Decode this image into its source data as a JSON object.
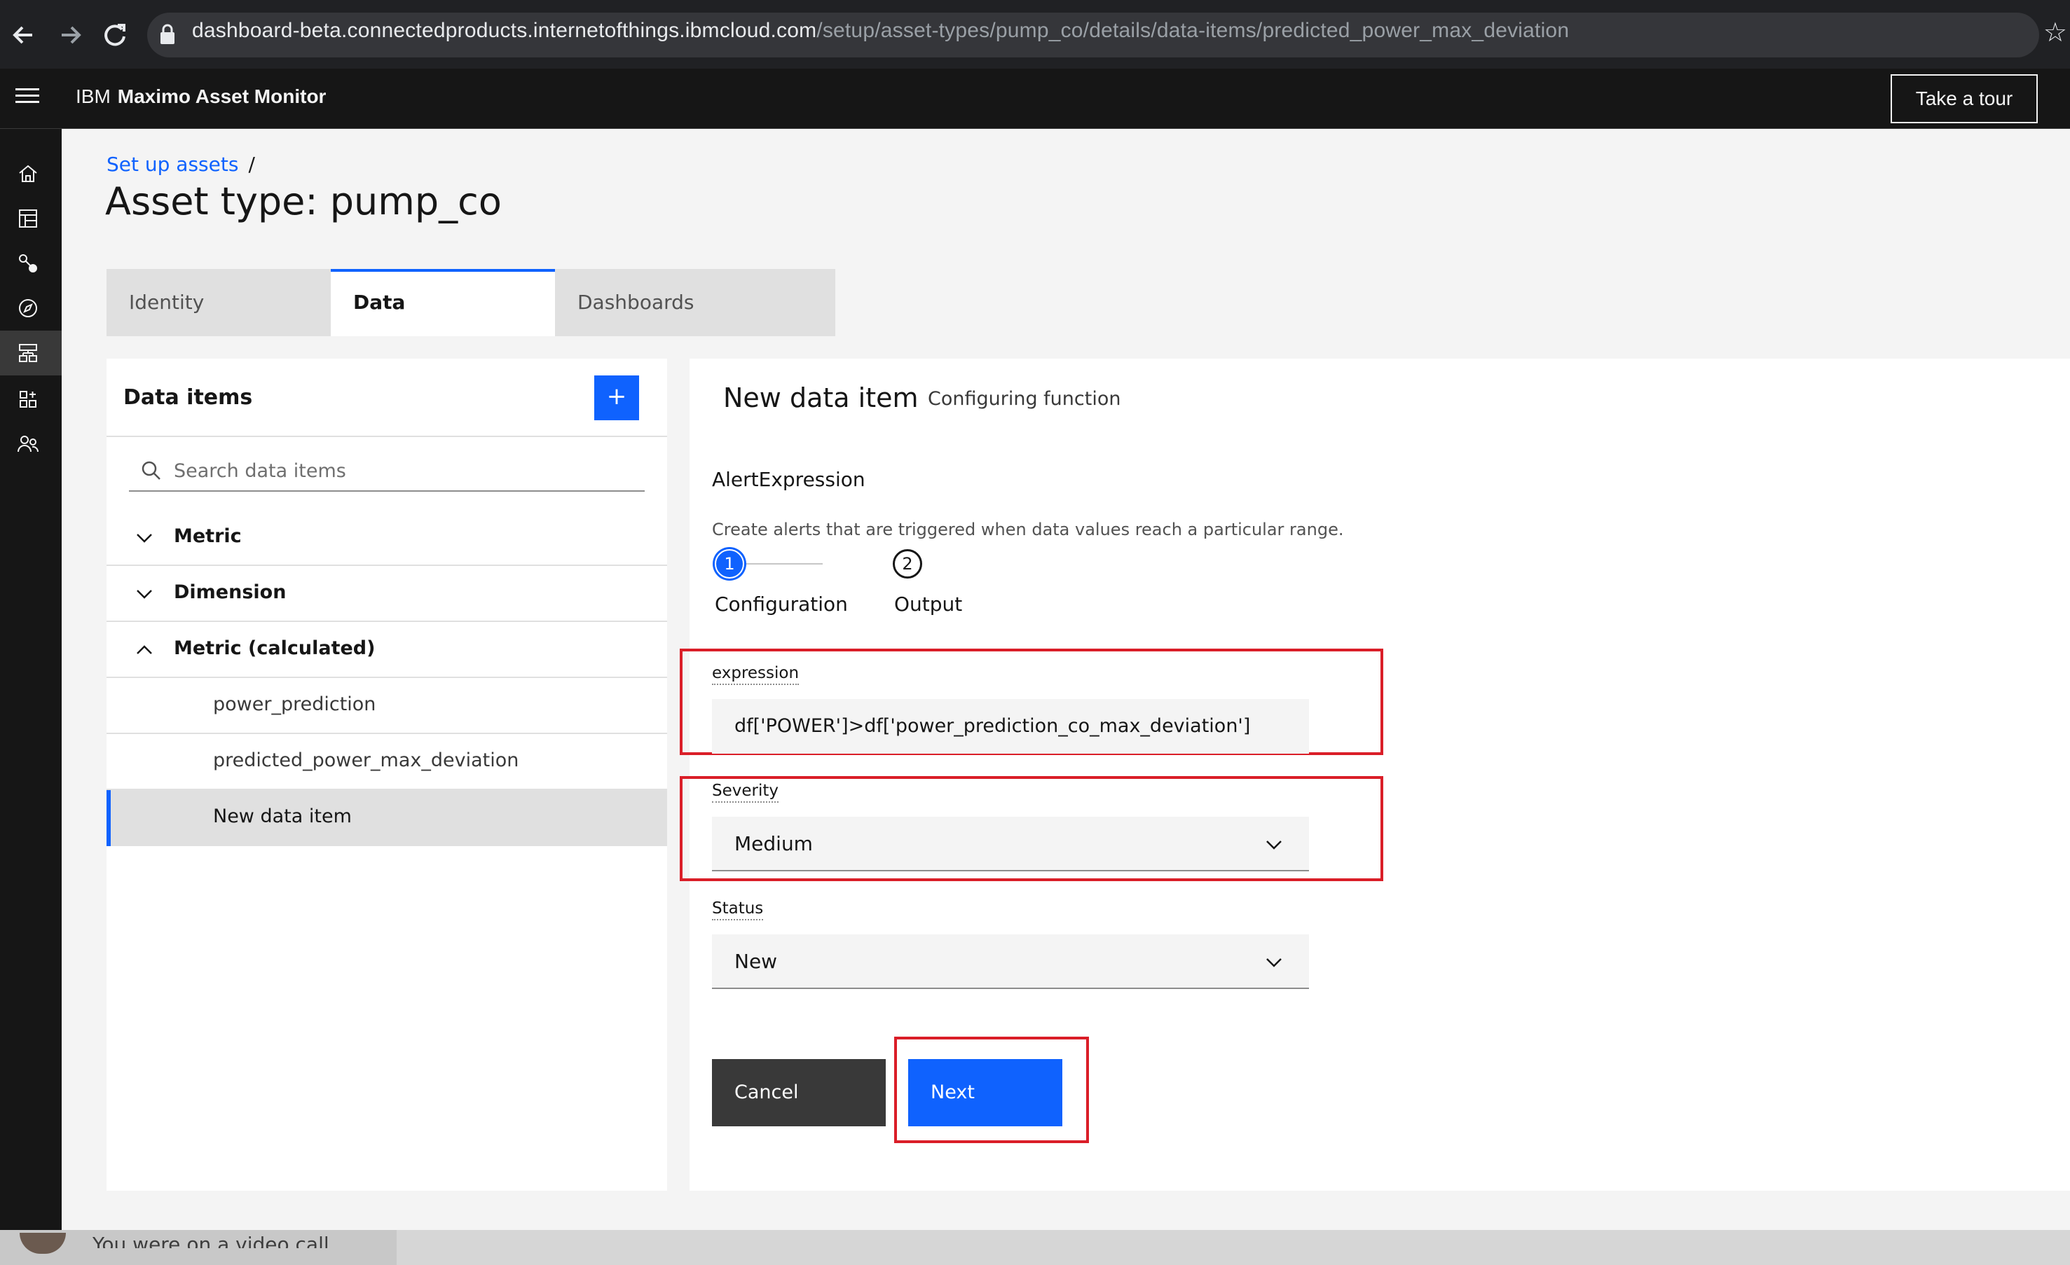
{
  "browser": {
    "url_host": "dashboard-beta.connectedproducts.internetofthings.ibmcloud.com",
    "url_path": "/setup/asset-types/pump_co/details/data-items/predicted_power_max_deviation"
  },
  "header": {
    "brand_ibm": "IBM",
    "brand_product": "Maximo Asset Monitor",
    "tour_label": "Take a tour"
  },
  "leftnav": {
    "icons": [
      "home-icon",
      "table-icon",
      "connection-icon",
      "compass-icon",
      "data-structure-icon",
      "apps-icon",
      "users-icon"
    ]
  },
  "page": {
    "breadcrumb_link": "Set up assets",
    "breadcrumb_sep": "/",
    "title": "Asset type: pump_co"
  },
  "tabs": [
    {
      "label": "Identity",
      "selected": false
    },
    {
      "label": "Data",
      "selected": true
    },
    {
      "label": "Dashboards",
      "selected": false
    }
  ],
  "data_items": {
    "title": "Data items",
    "add_label": "+",
    "search_placeholder": "Search data items",
    "groups": [
      {
        "label": "Metric",
        "expanded": false
      },
      {
        "label": "Dimension",
        "expanded": false
      },
      {
        "label": "Metric (calculated)",
        "expanded": true
      }
    ],
    "items": [
      "power_prediction",
      "predicted_power_max_deviation",
      "New data item"
    ]
  },
  "form": {
    "title": "New data item",
    "subtitle": "Configuring function",
    "function_name": "AlertExpression",
    "function_desc": "Create alerts that are triggered when data values reach a particular range.",
    "steps": [
      {
        "number": "1",
        "label": "Configuration"
      },
      {
        "number": "2",
        "label": "Output"
      }
    ],
    "expression_label": "expression",
    "expression_value": "df['POWER']>df['power_prediction_co_max_deviation']",
    "severity_label": "Severity",
    "severity_value": "Medium",
    "status_label": "Status",
    "status_value": "New",
    "cancel_label": "Cancel",
    "next_label": "Next"
  },
  "notification": {
    "text": "You were on a video call"
  },
  "colors": {
    "accent": "#0f62fe",
    "highlight": "#da1e28",
    "header_bg": "#161616"
  }
}
